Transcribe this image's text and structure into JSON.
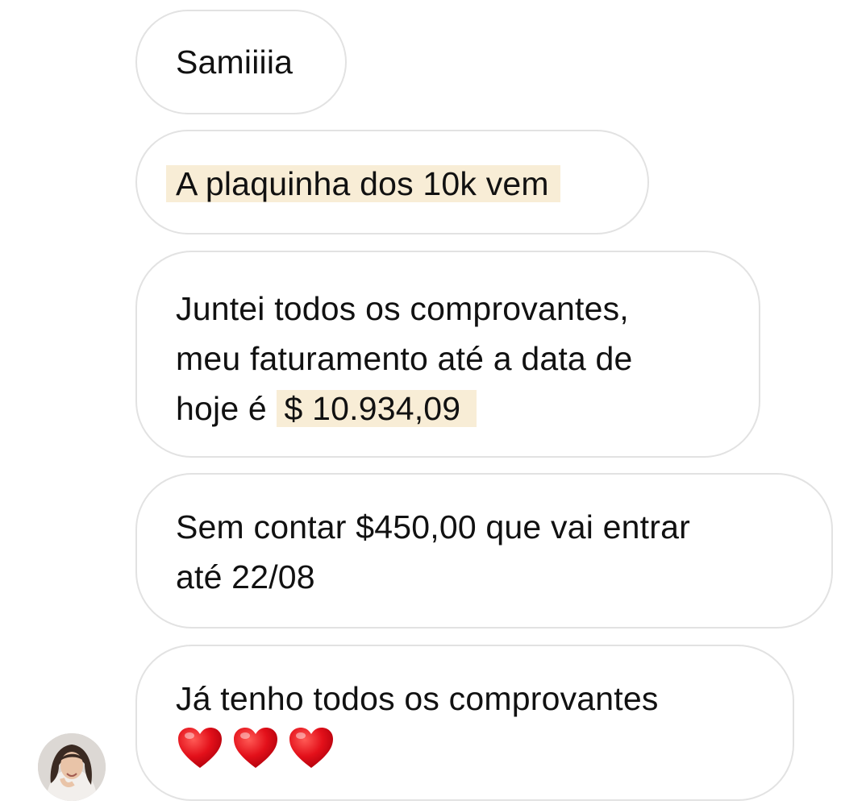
{
  "messages": [
    {
      "text": "Samiiiia"
    },
    {
      "highlight": "A plaquinha dos 10k vem"
    },
    {
      "line1": "Juntei todos os comprovantes,",
      "line2": "meu faturamento até a data de",
      "line3_prefix": "hoje é",
      "line3_highlight": "$ 10.934,09"
    },
    {
      "line1": "Sem contar $450,00 que vai entrar",
      "line2": "até 22/08"
    },
    {
      "line1": "Já tenho todos os comprovantes",
      "emojis": [
        "red-heart",
        "red-heart",
        "red-heart"
      ]
    }
  ],
  "colors": {
    "bubble_border": "#e2e2e2",
    "highlight": "#f8edd6",
    "heart": "#e0101b"
  },
  "avatar": {
    "icon": "profile-photo"
  }
}
